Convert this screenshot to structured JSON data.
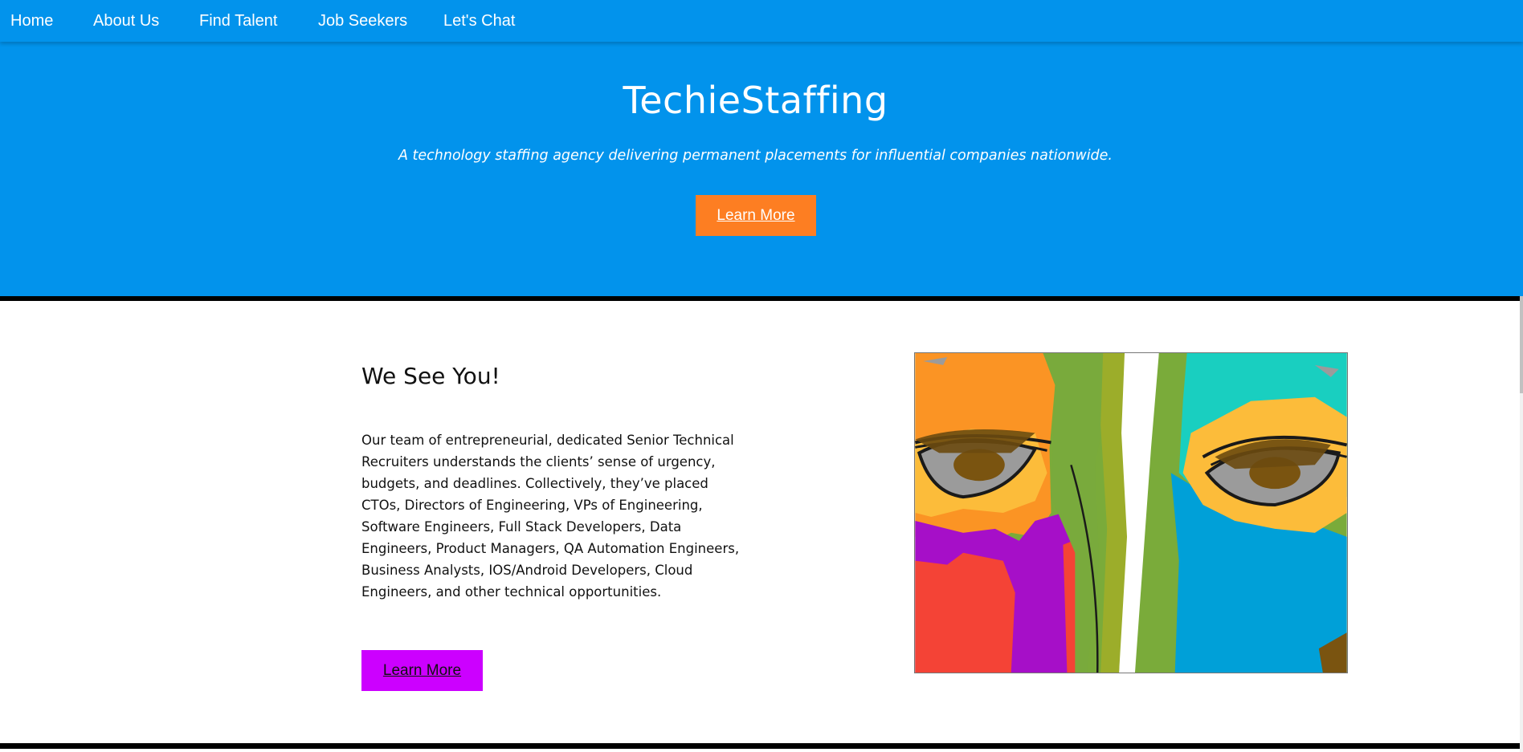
{
  "nav": {
    "items": [
      {
        "label": "Home"
      },
      {
        "label": "About Us"
      },
      {
        "label": "Find Talent"
      },
      {
        "label": "Job Seekers"
      },
      {
        "label": "Let's Chat"
      }
    ]
  },
  "hero": {
    "title": "TechieStaffing",
    "subtitle": "A technology staffing agency delivering permanent placements for influential companies nationwide.",
    "button_label": "Learn More"
  },
  "section": {
    "heading": "We See You!",
    "body": "Our team of entrepreneurial, dedicated Senior Technical Recruiters understands the clients’ sense of urgency, budgets, and deadlines. Collectively, they’ve placed CTOs, Directors of Engineering, VPs of Engineering, Software Engineers, Full Stack Developers, Data Engineers, Product Managers, QA Automation Engineers, Business Analysts, IOS/Android Developers, Cloud Engineers, and other technical opportunities.",
    "button_label": "Learn More",
    "image_icon": "abstract-eyes-painting"
  },
  "colors": {
    "primary_blue": "#0293ec",
    "hero_button": "#fd7e22",
    "section_button": "#cc00ff",
    "divider": "#000000"
  }
}
